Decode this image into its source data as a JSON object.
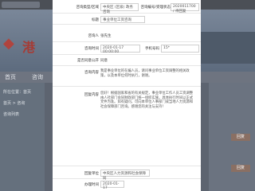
{
  "background": {
    "browser_tab": "",
    "logo_text": "港",
    "nav_items": [
      "首页",
      "咨询"
    ],
    "sidebar_items": [
      "所在位置：首页",
      "首页 > 咨询",
      "咨询列表"
    ],
    "right_buttons": [
      "回复",
      "回复"
    ]
  },
  "modal": {
    "fields": [
      {
        "label": "咨询类型/区域",
        "value": "中央区 (区级) 政务咨询"
      },
      {
        "label": "标题",
        "value": "事业单位工资咨询"
      },
      {
        "label": "咨询人",
        "value": "张先生"
      },
      {
        "label": "咨询时间",
        "value": "2020-01-17 00:00:00"
      },
      {
        "label": "是否同意公开",
        "value": "同意"
      }
    ],
    "extra_label": "咨询编号/受理状态",
    "extra_value": "2020011700 / 待回复",
    "phone_label": "手机号码",
    "phone_value": "15*",
    "question_label": "咨询内容",
    "question_text": "我是事业单位的在编人员，请问事业单位工资调整的相关政策，以及本单位何时执行，谢谢。",
    "answer_label": "回复内容",
    "answer_text": "您好！根据国家和省的有关规定，事业单位工作人员工资调整由人社部门会同财政部门统一组织实施，具体执行时间以正式文件为准。如有疑问，可向本单位人事部门或当地人力资源和社会保障部门咨询。感谢您的关注与支持！",
    "footer_label": "回复单位",
    "footer_value": "中央区人力资源和社会保障局",
    "last_label": "办理时间",
    "last_value": "2020-01-17"
  }
}
